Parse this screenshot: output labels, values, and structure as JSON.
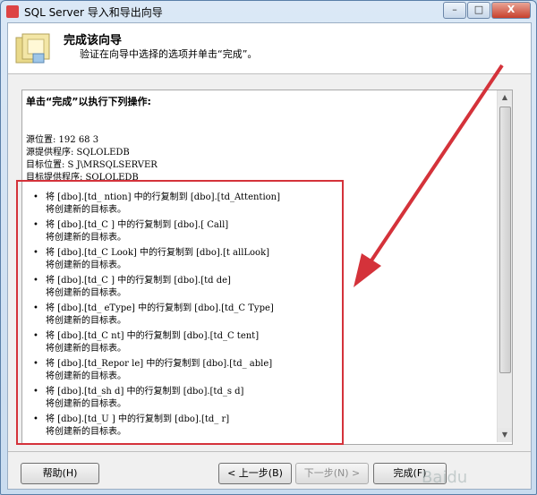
{
  "window": {
    "title": "SQL Server 导入和导出向导",
    "controls": {
      "minimize": "–",
      "maximize": "□",
      "close": "X"
    }
  },
  "header": {
    "title": "完成该向导",
    "subtitle": "验证在向导中选择的选项并单击“完成”。"
  },
  "summary": {
    "heading": "单击“完成”以执行下列操作:",
    "source_lines": [
      "源位置: 192  68  3",
      "源提供程序: SQLOLEDB",
      "目标位置: S    J\\MRSQLSERVER",
      "目标提供程序: SQLOLEDB"
    ],
    "operations": [
      {
        "text": "将 [dbo].[td_  ntion] 中的行复制到 [dbo].[td_Attention]",
        "note": "将创建新的目标表。"
      },
      {
        "text": "将 [dbo].[td_C  ] 中的行复制到 [dbo].[  Call]",
        "note": "将创建新的目标表。"
      },
      {
        "text": "将 [dbo].[td_C  Look] 中的行复制到 [dbo].[t  allLook]",
        "note": "将创建新的目标表。"
      },
      {
        "text": "将 [dbo].[td_C  ] 中的行复制到 [dbo].[td  de]",
        "note": "将创建新的目标表。"
      },
      {
        "text": "将 [dbo].[td_  eType] 中的行复制到 [dbo].[td_C  Type]",
        "note": "将创建新的目标表。"
      },
      {
        "text": "将 [dbo].[td_C  nt] 中的行复制到 [dbo].[td_C  tent]",
        "note": "将创建新的目标表。"
      },
      {
        "text": "将 [dbo].[td_Repor  le] 中的行复制到 [dbo].[td_  able]",
        "note": "将创建新的目标表。"
      },
      {
        "text": "将 [dbo].[td_sh  d] 中的行复制到 [dbo].[td_s  d]",
        "note": "将创建新的目标表。"
      },
      {
        "text": "将 [dbo].[td_U  ] 中的行复制到 [dbo].[td_  r]",
        "note": "将创建新的目标表。"
      }
    ],
    "bullet": "•"
  },
  "buttons": {
    "help": "帮助(H)",
    "back": "< 上一步(B)",
    "next": "下一步(N) >",
    "finish": "完成(F)"
  },
  "watermark": "Baidu",
  "colors": {
    "highlight_box": "#d4323a",
    "arrow": "#d4323a"
  }
}
